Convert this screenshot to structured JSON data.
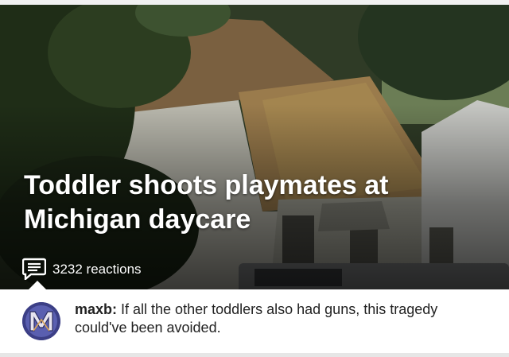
{
  "article": {
    "headline": "Toddler shoots playmates at Michigan daycare",
    "reactions_icon": "comment-icon",
    "reactions_label": "3232 reactions"
  },
  "top_comment": {
    "avatar_icon": "avatar-m-icon",
    "user": "maxb:",
    "text": " If all the other toddlers also had guns, this tragedy could've been avoided."
  },
  "colors": {
    "headline_text": "#ffffff",
    "avatar_bg": "#3c3f86",
    "comment_text": "#222222"
  }
}
